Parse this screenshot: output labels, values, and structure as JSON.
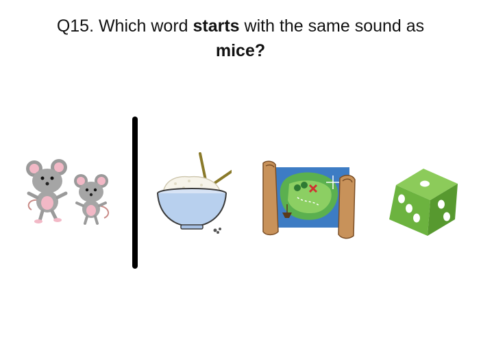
{
  "question": {
    "prefix": "Q15. Which word ",
    "emphasis": "starts",
    "middle": " with the same sound as",
    "target_word": "mice?"
  },
  "images": {
    "prompt": "mice-icon",
    "choices": [
      "rice-bowl-icon",
      "treasure-map-icon",
      "dice-icon"
    ]
  },
  "colors": {
    "divider": "#000000",
    "dice_green": "#6cb33f",
    "bowl_blue": "#b8d0ee"
  }
}
